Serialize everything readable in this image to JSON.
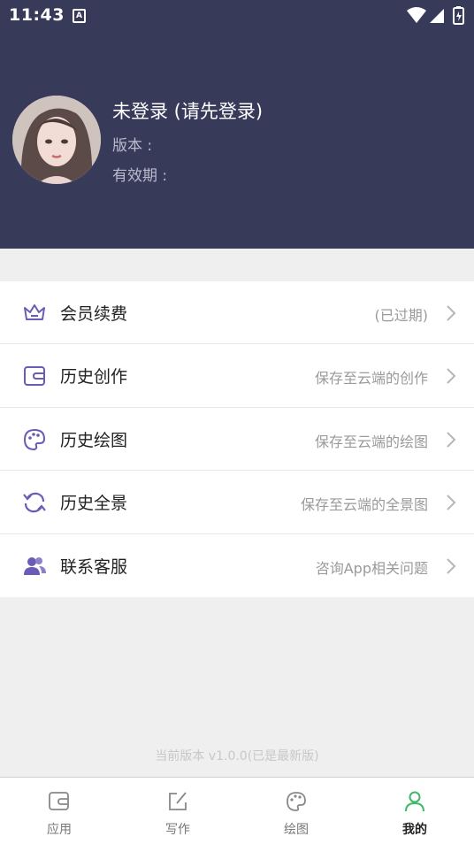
{
  "status_bar": {
    "time": "11:43",
    "notification_icon": "a-badge-icon",
    "icons": [
      "wifi-icon",
      "signal-icon",
      "battery-icon"
    ]
  },
  "profile": {
    "title": "未登录 (请先登录)",
    "version_label": "版本 :",
    "expiry_label": "有效期 :",
    "avatar_icon": "avatar-portrait"
  },
  "menu": {
    "items": [
      {
        "icon": "crown-icon",
        "label": "会员续费",
        "sub": "(已过期)"
      },
      {
        "icon": "wallet-icon",
        "label": "历史创作",
        "sub": "保存至云端的创作"
      },
      {
        "icon": "palette-icon",
        "label": "历史绘图",
        "sub": "保存至云端的绘图"
      },
      {
        "icon": "refresh-icon",
        "label": "历史全景",
        "sub": "保存至云端的全景图"
      },
      {
        "icon": "users-icon",
        "label": "联系客服",
        "sub": "咨询App相关问题"
      }
    ]
  },
  "footer": {
    "version_text": "当前版本 v1.0.0(已是最新版)"
  },
  "tabbar": {
    "tabs": [
      {
        "icon": "wallet-icon",
        "label": "应用"
      },
      {
        "icon": "edit-icon",
        "label": "写作"
      },
      {
        "icon": "palette-icon",
        "label": "绘图"
      },
      {
        "icon": "user-icon",
        "label": "我的",
        "active": true
      }
    ]
  },
  "colors": {
    "header_bg": "#383a5a",
    "accent_purple": "#6a5cb5",
    "active_tab_green": "#3fb86c"
  }
}
